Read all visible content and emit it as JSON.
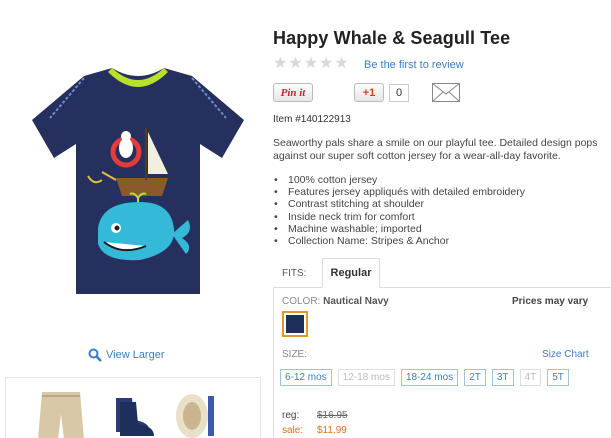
{
  "product": {
    "title": "Happy Whale & Seagull Tee",
    "review_link": "Be the first to review",
    "rating_stars": 0,
    "pinit_label": "Pin it",
    "gplus_label": "+1",
    "gplus_count": "0",
    "item_number": "Item #140122913",
    "description": "Seaworthy pals share a smile on our playful tee. Detailed design pops against our super soft cotton jersey for a wear-all-day favorite.",
    "features": [
      "100% cotton jersey",
      "Features jersey appliqués with detailed embroidery",
      "Contrast stitching at shoulder",
      "Inside neck trim for comfort",
      "Machine washable; imported",
      "Collection Name: Stripes & Anchor"
    ]
  },
  "gallery": {
    "view_larger": "View Larger"
  },
  "fits": {
    "label": "FITS:",
    "selected_tab": "Regular"
  },
  "options": {
    "color_label": "COLOR:",
    "color_value": "Nautical Navy",
    "prices_vary": "Prices may vary",
    "swatch_color": "#1f2f5b",
    "size_label": "SIZE:",
    "size_chart": "Size Chart",
    "sizes": [
      {
        "label": "6-12 mos",
        "available": true
      },
      {
        "label": "12-18 mos",
        "available": false
      },
      {
        "label": "18-24 mos",
        "available": true
      },
      {
        "label": "2T",
        "available": true
      },
      {
        "label": "3T",
        "available": true
      },
      {
        "label": "4T",
        "available": false
      },
      {
        "label": "5T",
        "available": true
      }
    ]
  },
  "pricing": {
    "reg_label": "reg:",
    "reg_price": "$16.95",
    "sale_label": "sale:",
    "sale_price": "$11.99"
  },
  "colors": {
    "link": "#3a7fbf",
    "sale": "#e0701a",
    "shirt_navy": "#26305e",
    "whale": "#35b9d8"
  }
}
